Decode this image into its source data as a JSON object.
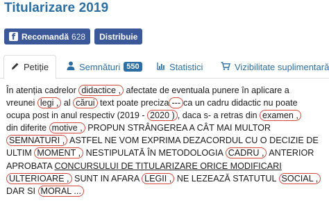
{
  "page": {
    "title": "Titularizare 2019"
  },
  "actions": {
    "recommend_label": "Recomandă",
    "recommend_count": "628",
    "share_label": "Distribuie"
  },
  "tabs": [
    {
      "label": "Petiție",
      "icon": "pencil-icon"
    },
    {
      "label": "Semnături",
      "icon": "user-icon",
      "badge": "550"
    },
    {
      "label": "Statistici",
      "icon": "bar-chart-icon"
    },
    {
      "label": "Vizibilitate suplimentară",
      "icon": "cart-icon"
    }
  ],
  "petition": {
    "l1a": "În atenția cadrelor ",
    "l1b": "didactice ,",
    "l1c": " afectate de eventuala punere în aplicare a",
    "l2a": "vreunei ",
    "l2b": "legi ,",
    "l2c": " al ",
    "l2d": "cărui",
    "l2e": " text poate preciza",
    "l2f": "---",
    "l2g": "ca un cadru didactic nu poate",
    "l3a": "ocupa post in anul respectiv (2019 - ",
    "l3b": "2020 )",
    "l3c": ", daca s- a retras din ",
    "l3d": "examen ,",
    "l4a": "din diferite ",
    "l4b": "motive ,",
    "l4c": " PROPUN STRÂNGEREA A CÂT MAI MULTOR",
    "l5a": "SEMNATURI ,",
    "l5b": " ASTFEL NE VOM EXPRIMA DEZACORDUL CU O DECIZIE DE",
    "l6a": "ULTIM ",
    "l6b": "MOMENT ,",
    "l6c": " NESTIPULATĂ ÎN  METODOLOGIA ",
    "l6d": "CADRU ,",
    "l6e": " ANTERIOR",
    "l7a": "APROBATA  ",
    "l7b": "CONCURSULUI DE TITULARIZARE ORICE MODIFICARI",
    "l8a": "ULTERIOARE ,",
    "l8b": " SUNT IN AFARA ",
    "l8c": "LEGII ,",
    "l8d": " NE LEZEAZĂ STATUTUL ",
    "l8e": "SOCIAL ,",
    "l9a": "DAR SI ",
    "l9b": "MORAL ..."
  },
  "colors": {
    "accent": "#2d6fa3",
    "facebook": "#3b5998",
    "annotation": "#d24a3a"
  }
}
